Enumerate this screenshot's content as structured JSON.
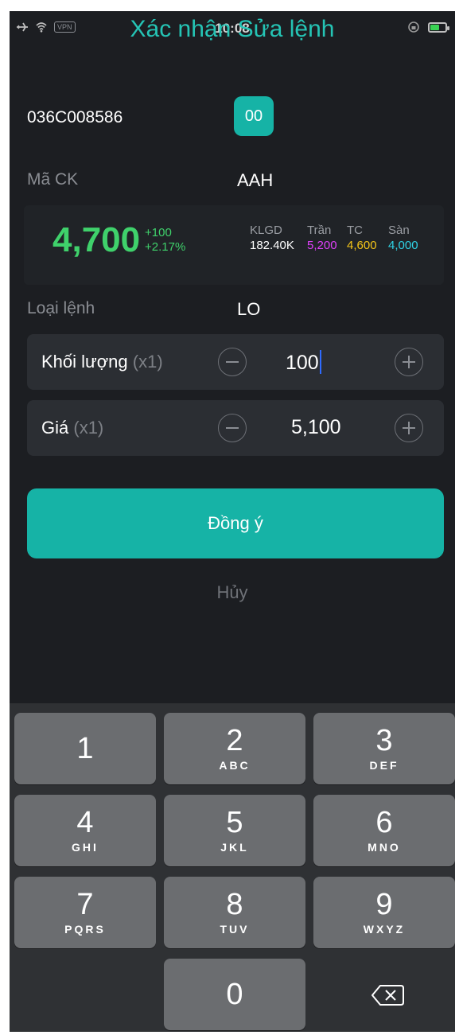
{
  "status_bar": {
    "time": "10:08",
    "vpn_label": "VPN"
  },
  "header": {
    "title": "Xác nhận Sửa lệnh"
  },
  "account": {
    "number": "036C008586",
    "sub_account": "00"
  },
  "symbol": {
    "label": "Mã CK",
    "value": "AAH"
  },
  "quote": {
    "price": "4,700",
    "change": "+100",
    "change_pct": "+2.17%",
    "klgd_label": "KLGD",
    "klgd_value": "182.40K",
    "tran_label": "Trần",
    "tran_value": "5,200",
    "tc_label": "TC",
    "tc_value": "4,600",
    "san_label": "Sàn",
    "san_value": "4,000"
  },
  "order_type": {
    "label": "Loại lệnh",
    "value": "LO"
  },
  "quantity": {
    "label": "Khối lượng",
    "multiplier": "(x1)",
    "value": "100"
  },
  "price_field": {
    "label": "Giá",
    "multiplier": "(x1)",
    "value": "5,100"
  },
  "actions": {
    "confirm": "Đồng ý",
    "cancel": "Hủy"
  },
  "keypad": {
    "keys": [
      {
        "digit": "1",
        "letters": ""
      },
      {
        "digit": "2",
        "letters": "ABC"
      },
      {
        "digit": "3",
        "letters": "DEF"
      },
      {
        "digit": "4",
        "letters": "GHI"
      },
      {
        "digit": "5",
        "letters": "JKL"
      },
      {
        "digit": "6",
        "letters": "MNO"
      },
      {
        "digit": "7",
        "letters": "PQRS"
      },
      {
        "digit": "8",
        "letters": "TUV"
      },
      {
        "digit": "9",
        "letters": "WXYZ"
      },
      {
        "digit": "0",
        "letters": ""
      }
    ]
  },
  "colors": {
    "accent": "#16b3a6",
    "up": "#3fd16b",
    "ceiling": "#e040fb",
    "reference": "#f5c518",
    "floor": "#2fd3e6"
  }
}
